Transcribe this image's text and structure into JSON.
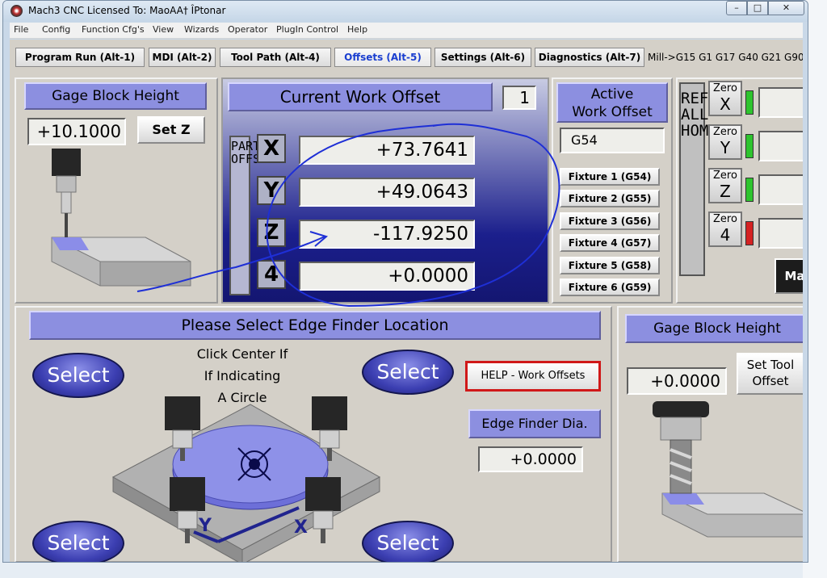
{
  "window": {
    "title": "Mach3 CNC  Licensed To: MaoAA† ÎPtonar",
    "minimize": "–",
    "maximize": "□",
    "close": "✕"
  },
  "menu": [
    "File",
    "Config",
    "Function Cfg's",
    "View",
    "Wizards",
    "Operator",
    "PlugIn Control",
    "Help"
  ],
  "tabs": [
    {
      "label": "Program Run (Alt-1)"
    },
    {
      "label": "MDI (Alt-2)"
    },
    {
      "label": "Tool Path (Alt-4)"
    },
    {
      "label": "Offsets (Alt-5)"
    },
    {
      "label": "Settings (Alt-6)"
    },
    {
      "label": "Diagnostics (Alt-7)"
    }
  ],
  "status_line": "Mill->G15  G1 G17 G40 G21 G90",
  "gage_block": {
    "title": "Gage Block Height",
    "value": "+10.1000",
    "set_label": "Set Z"
  },
  "work_offset": {
    "title": "Current Work Offset",
    "number": "1",
    "part_offset_label": "PART\nOFFSET",
    "axes": [
      {
        "label": "X",
        "value": "+73.7641"
      },
      {
        "label": "Y",
        "value": "+49.0643"
      },
      {
        "label": "Z",
        "value": "-117.9250"
      },
      {
        "label": "4",
        "value": "+0.0000"
      }
    ]
  },
  "active_offset": {
    "title_line1": "Active",
    "title_line2": "Work Offset",
    "value": "G54",
    "fixtures": [
      "Fixture 1 (G54)",
      "Fixture 2 (G55)",
      "Fixture 3 (G56)",
      "Fixture 4 (G57)",
      "Fixture 5 (G58)",
      "Fixture 6 (G59)"
    ]
  },
  "ref_all_home": {
    "label": "REF\nALL\nHOME"
  },
  "zero_buttons": [
    {
      "top": "Zero",
      "axis": "X",
      "led": "#2ec42e"
    },
    {
      "top": "Zero",
      "axis": "Y",
      "led": "#2ec42e"
    },
    {
      "top": "Zero",
      "axis": "Z",
      "led": "#2ec42e"
    },
    {
      "top": "Zero",
      "axis": "4",
      "led": "#d42222"
    }
  ],
  "partial_button": "Ma",
  "edge_finder": {
    "title": "Please Select Edge Finder Location",
    "select_label": "Select",
    "center_text_1": "Click Center If",
    "center_text_2": "If Indicating",
    "center_text_3": "A Circle",
    "axis_y": "Y",
    "axis_x": "X",
    "help_label": "HELP - Work Offsets",
    "dia_label": "Edge Finder Dia.",
    "dia_value": "+0.0000"
  },
  "tool_gage": {
    "title": "Gage Block Height",
    "value": "+0.0000",
    "set_line1": "Set Tool",
    "set_line2": "Offset"
  },
  "colors": {
    "panel_header": "#8c8fe0",
    "select_button": "#3c3fb2",
    "annotation_ink": "#1e2fd6"
  }
}
